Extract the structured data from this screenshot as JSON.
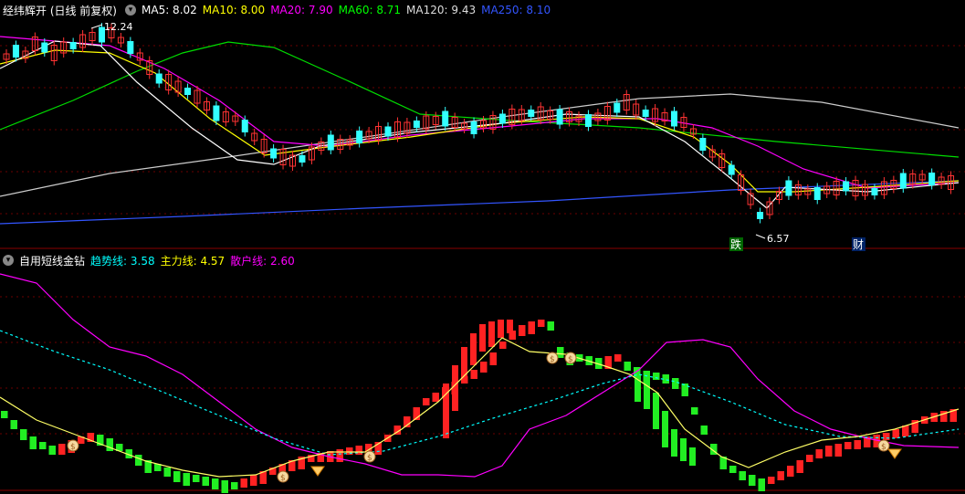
{
  "main": {
    "title": "经纬辉开 (日线 前复权)",
    "ma": [
      {
        "label": "MA5: 8.02",
        "color": "#ffffff"
      },
      {
        "label": "MA10: 8.00",
        "color": "#ffff00"
      },
      {
        "label": "MA20: 7.90",
        "color": "#ff00ff"
      },
      {
        "label": "MA60: 8.71",
        "color": "#00ff00"
      },
      {
        "label": "MA120: 9.43",
        "color": "#dddddd"
      },
      {
        "label": "MA250: 8.10",
        "color": "#3355ff"
      }
    ],
    "high_label": "12.24",
    "low_label": "6.57",
    "badge_drop": "跌",
    "badge_cai": "财"
  },
  "indicator": {
    "title": "自用短线金钻",
    "lines": [
      {
        "label": "趋势线: 3.58",
        "color": "#00ffff"
      },
      {
        "label": "主力线: 4.57",
        "color": "#ffff00"
      },
      {
        "label": "散户线: 2.60",
        "color": "#ff00ff"
      }
    ]
  },
  "colors": {
    "up": "#ff3333",
    "down": "#33ffff",
    "bull": "#ff2222",
    "bear": "#22ee22"
  }
}
